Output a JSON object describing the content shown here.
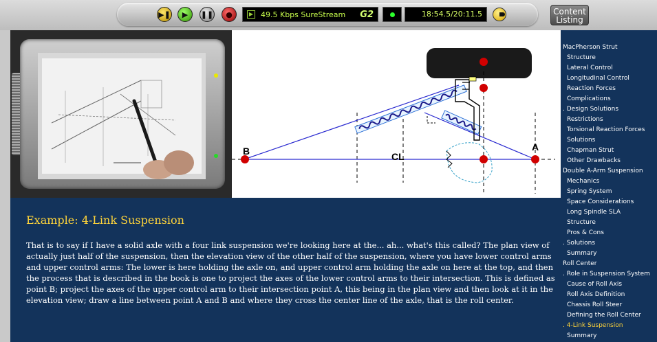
{
  "player": {
    "buttons": [
      {
        "name": "play-pause-button",
        "icon": "play-pause-icon"
      },
      {
        "name": "play-button",
        "icon": "play-icon"
      },
      {
        "name": "pause-button",
        "icon": "pause-icon"
      },
      {
        "name": "stop-button",
        "icon": "stop-icon"
      }
    ],
    "bitrate": "49.5 Kbps SureStream",
    "codec_logo": "G2",
    "time": "18:54.5/20:11.5"
  },
  "content_listing": {
    "line1": "Content",
    "line2": "Listing"
  },
  "diagram": {
    "point_a": "A",
    "point_b": "B",
    "centerline": "CL"
  },
  "transcript": {
    "title": "Example:  4-Link Suspension",
    "body": "That is to say if I have a solid axle with a four link suspension we're looking here at the... ah... what's this called? The plan view of actually just half of the suspension, then the elevation view of the other half of the suspension, where you have lower control arms and upper control arms:   The lower is here holding the axle on, and upper control arm holding the axle on here at the top, and then the process that is described in the book is one to project the axes of the lower control arms to their intersection. This is defined as point B;  project the axes of the upper control arm to their intersection point A, this being in the plan view and then look at it in the elevation view; draw a line between point A and B and where they cross the center line of the axle, that is the roll center."
  },
  "sidebar": {
    "items": [
      {
        "label": "MacPherson Strut",
        "level": 0,
        "active": false
      },
      {
        "label": "Structure",
        "level": 1,
        "active": false
      },
      {
        "label": "Lateral Control",
        "level": 1,
        "active": false
      },
      {
        "label": "Longitudinal Control",
        "level": 1,
        "active": false
      },
      {
        "label": "Reaction Forces",
        "level": 1,
        "active": false
      },
      {
        "label": "Complications",
        "level": 1,
        "active": false
      },
      {
        "label": ". Design Solutions",
        "level": 0,
        "active": false
      },
      {
        "label": "Restrictions",
        "level": 1,
        "active": false
      },
      {
        "label": "Torsional Reaction Forces",
        "level": 1,
        "active": false
      },
      {
        "label": "Solutions",
        "level": 1,
        "active": false
      },
      {
        "label": "Chapman Strut",
        "level": 1,
        "active": false
      },
      {
        "label": "Other Drawbacks",
        "level": 1,
        "active": false
      },
      {
        "label": "Double A-Arm Suspension",
        "level": 0,
        "active": false
      },
      {
        "label": "Mechanics",
        "level": 1,
        "active": false
      },
      {
        "label": "Spring System",
        "level": 1,
        "active": false
      },
      {
        "label": "Space Considerations",
        "level": 1,
        "active": false
      },
      {
        "label": "Long Spindle SLA",
        "level": 1,
        "active": false
      },
      {
        "label": "Structure",
        "level": 1,
        "active": false
      },
      {
        "label": "Pros & Cons",
        "level": 1,
        "active": false
      },
      {
        "label": ". Solutions",
        "level": 0,
        "active": false
      },
      {
        "label": "Summary",
        "level": 1,
        "active": false
      },
      {
        "label": "Roll Center",
        "level": 0,
        "active": false
      },
      {
        "label": ". Role in Suspension System",
        "level": 0,
        "active": false
      },
      {
        "label": "Cause of Roll Axis",
        "level": 1,
        "active": false
      },
      {
        "label": "Roll Axis Definition",
        "level": 1,
        "active": false
      },
      {
        "label": "Chassis Roll Steer",
        "level": 1,
        "active": false
      },
      {
        "label": "Defining the Roll Center",
        "level": 1,
        "active": false
      },
      {
        "label": ". 4-Link Suspension",
        "level": 0,
        "active": true
      },
      {
        "label": "Summary",
        "level": 1,
        "active": false
      }
    ]
  }
}
